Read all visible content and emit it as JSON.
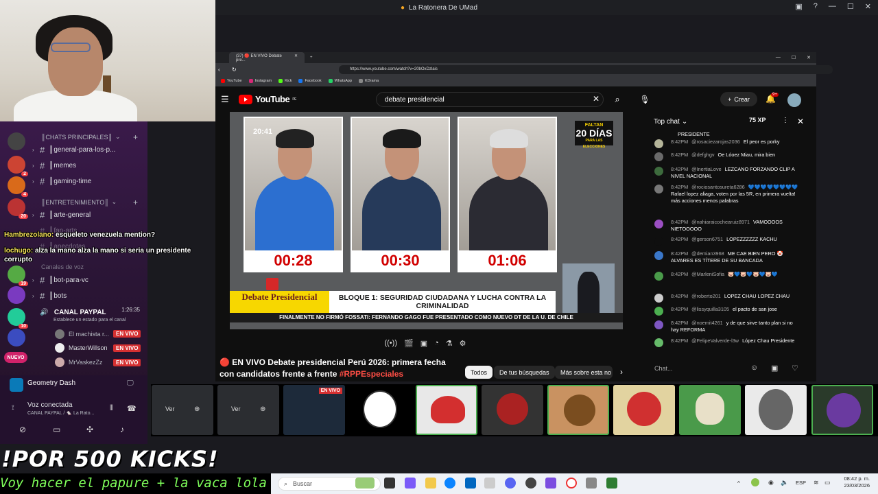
{
  "window": {
    "title": "La Ratonera De UMad"
  },
  "discord": {
    "categories": [
      {
        "label": "║CHATS PRINCIPALES║"
      },
      {
        "label": "║ENTRETENIMIENTO║"
      },
      {
        "label": "Canales de voz"
      }
    ],
    "channels": [
      {
        "label": "║general-para-los-p..."
      },
      {
        "label": "║memes"
      },
      {
        "label": "║gaming-time"
      },
      {
        "label": "║arte-general"
      },
      {
        "label": "║fan-arts"
      },
      {
        "label": "║anecdotas"
      },
      {
        "label": "║bot-para-vc"
      },
      {
        "label": "║bots"
      }
    ],
    "voice_channel": {
      "label": "CANAL PAYPAL",
      "time": "1:26:35",
      "status_hint": "Establece un estado para el canal"
    },
    "voice_users": [
      {
        "name": "El machista r...",
        "badge": "EN VIVO"
      },
      {
        "name": "MasterWillson",
        "badge": "EN VIVO"
      },
      {
        "name": "MrVaskezZz",
        "badge": "EN VIVO"
      }
    ],
    "server_badges": [
      "2",
      "4",
      "20",
      "19",
      "10",
      "NUEVO"
    ],
    "game_activity": "Geometry Dash",
    "voice_status": {
      "title": "Voz conectada",
      "subtitle": "CANAL PAYPAL / 🐁 La Rato..."
    }
  },
  "overlay_chat": [
    {
      "name": "Hambrezolano:",
      "text": " esqueleto venezuela mention?"
    },
    {
      "name": "lochugo:",
      "text": " alza la mano alza la mano si seria un presidente corrupto"
    }
  ],
  "browser": {
    "tab_title": "(37) 🔴 EN VIVO Debate pre...",
    "url": "https://www.youtube.com/watch?v=20bOxDzlais",
    "bookmarks": [
      "YouTube",
      "Instagram",
      "Kick",
      "Facebook",
      "WhatsApp",
      "KDrama"
    ]
  },
  "youtube": {
    "logo": "YouTube",
    "logo_region": "PE",
    "search_value": "debate presidencial",
    "create_label": "Crear",
    "notif_count": "9+",
    "video": {
      "clock": "20:41",
      "timers": [
        "00:28",
        "00:30",
        "01:06"
      ],
      "faltan_top": "FALTAN",
      "faltan_big": "20 DÍAS",
      "faltan_bottom": "PARA LAS ELECCIONES",
      "lower_left": "Debate Presidencial",
      "lower_right": "BLOQUE 1: SEGURIDAD CIUDADANA Y LUCHA CONTRA LA CRIMINALIDAD",
      "ticker": "FINALMENTE NO FIRMÓ FOSSATI: FERNANDO GAGO FUE PRESENTADO COMO NUEVO DT DE LA U. DE CHILE"
    },
    "title_prefix": "🔴 EN VIVO Debate presidencial Perú 2026: primera fecha con candidatos frente a frente ",
    "title_tag": "#RPPEspeciales",
    "chips": [
      "Todos",
      "De tus búsquedas",
      "Más sobre esta no"
    ]
  },
  "live_chat": {
    "header": "Top chat",
    "xp": "75 XP",
    "input_placeholder": "Chat...",
    "messages": [
      {
        "time": "",
        "user": "",
        "text": "PRESIDENTE",
        "color": "#0f0f0f"
      },
      {
        "time": "8:42PM",
        "user": "@rosaciezarojas2036",
        "text": "El peor es porky",
        "color": "#b5b59a"
      },
      {
        "time": "8:42PM",
        "user": "@defghgv",
        "text": "Oe Lóoez Miau, mira bien",
        "color": "#6a6a6a"
      },
      {
        "time": "8:42PM",
        "user": "@InertiaLove",
        "text": "LEZCANO FORZANDO CLIP A NIVEL NACIONAL",
        "color": "#3d6b3d"
      },
      {
        "time": "8:42PM",
        "user": "@rociosantosureta6286",
        "text": "💙💙💙💙💙💙💙💙 Rafael lopez aliaga, voten por las 5R, en primera vuelta! más acciones menos palabras",
        "color": "#777"
      },
      {
        "time": "8:42PM",
        "user": "@nahiaraicochearuiz8971",
        "text": "VAMOOOOS NIETOOOOO",
        "color": "#9b4fc2"
      },
      {
        "time": "8:42PM",
        "user": "@gerson6751",
        "text": "LOPEZZZZZZ KACHU",
        "color": "#0f0f0f"
      },
      {
        "time": "8:42PM",
        "user": "@demian3968",
        "text": "ME CAE BIEN PERO 🤡 ALVARES ES TÍTERE DE SU BANCADA",
        "color": "#3a77c9"
      },
      {
        "time": "8:42PM",
        "user": "@MarleniSofia",
        "text": "🐷💙🐷💙🐷💙🐷💙",
        "color": "#4a9b4a"
      },
      {
        "time": "8:42PM",
        "user": "@roberto201",
        "text": "LOPEZ CHAU LOPEZ CHAU",
        "color": "#ccc"
      },
      {
        "time": "8:42PM",
        "user": "@lissyquilla3105",
        "text": "el pacto de san jose",
        "color": "#4caf50"
      },
      {
        "time": "8:42PM",
        "user": "@noemit4261",
        "text": "y de que sirve tanto plan si no hay REFORMA",
        "color": "#7e57c2"
      },
      {
        "time": "8:42PM",
        "user": "@FelipeValverde-l3w",
        "text": "López Chau Presidente",
        "color": "#66bb6a"
      }
    ]
  },
  "strip": {
    "view_label": "Ver",
    "live_badge": "EN VIVO"
  },
  "overlay": {
    "big_title": "!POR 500 KICKS!",
    "scroll_text": "Voy hacer el papure + la vaca lola"
  },
  "taskbar": {
    "search_placeholder": "Buscar",
    "lang": "ESP",
    "time": "08:42 p. m.",
    "date": "23/03/2026"
  },
  "colors": {
    "accent_live": "#d63031",
    "yt_red": "#ff0000",
    "timer_red": "#d10000",
    "banner_yellow": "#f7d700"
  }
}
